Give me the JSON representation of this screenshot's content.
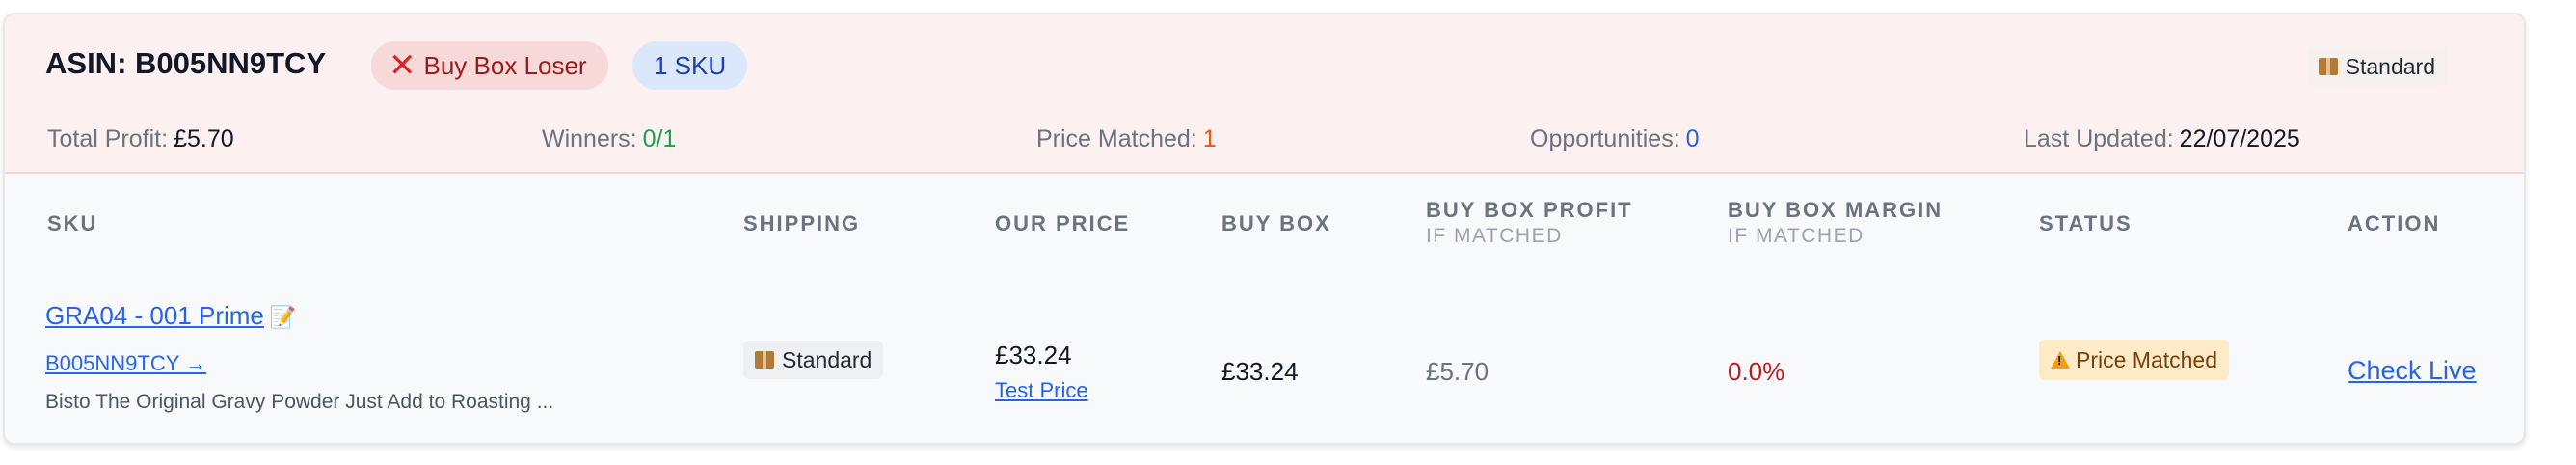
{
  "header": {
    "asin_label": "ASIN: B005NN9TCY",
    "buy_box_badge": "Buy Box Loser",
    "sku_count_badge": "1 SKU",
    "shipping_type": "Standard",
    "stats": {
      "total_profit_label": "Total Profit:",
      "total_profit_value": "£5.70",
      "winners_label": "Winners:",
      "winners_value": "0/1",
      "price_matched_label": "Price Matched:",
      "price_matched_value": "1",
      "opportunities_label": "Opportunities:",
      "opportunities_value": "0",
      "last_updated_label": "Last Updated:",
      "last_updated_value": "22/07/2025"
    }
  },
  "table": {
    "columns": {
      "sku": "SKU",
      "shipping": "SHIPPING",
      "our_price": "OUR PRICE",
      "buy_box": "BUY BOX",
      "buy_box_profit": "BUY BOX PROFIT",
      "buy_box_profit_sub": "IF MATCHED",
      "buy_box_margin": "BUY BOX MARGIN",
      "buy_box_margin_sub": "IF MATCHED",
      "status": "STATUS",
      "action": "ACTION"
    },
    "rows": [
      {
        "sku": "GRA04 - 001 Prime",
        "asin_link": "B005NN9TCY →",
        "description": "Bisto The Original Gravy Powder Just Add to Roasting ...",
        "shipping": "Standard",
        "our_price": "£33.24",
        "test_price_link": "Test Price",
        "buy_box": "£33.24",
        "buy_box_profit": "£5.70",
        "buy_box_margin": "0.0%",
        "status": "Price Matched",
        "action": "Check Live"
      }
    ]
  },
  "colors": {
    "header_bg": "#fcf0f0",
    "loser_red": "#dc2626",
    "link_blue": "#2563eb",
    "winners_green": "#16a34a",
    "price_matched_orange": "#ea580c",
    "margin_red": "#b91c1c",
    "status_bg": "#fdebc8"
  },
  "icons": {
    "loser_icon": "x-icon",
    "shipping_icon": "package-icon",
    "sku_note_icon": "memo-icon",
    "status_icon": "warning-icon"
  }
}
